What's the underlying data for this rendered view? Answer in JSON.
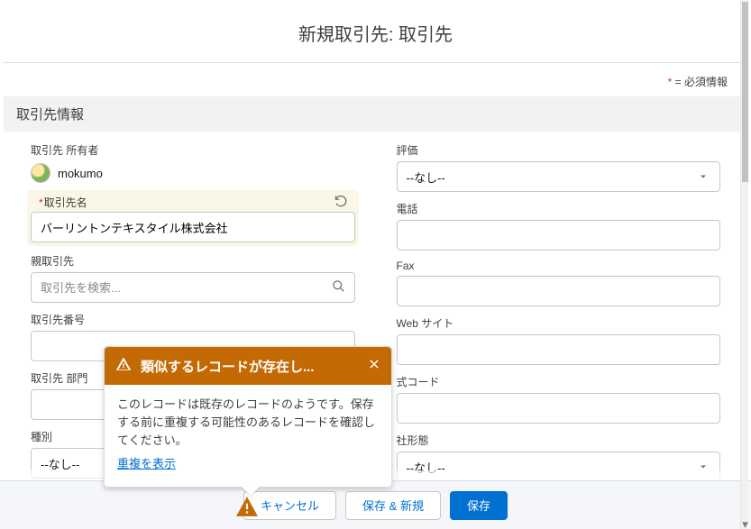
{
  "header": {
    "title": "新規取引先: 取引先",
    "required_legend": " = 必須情報"
  },
  "section": {
    "title": "取引先情報"
  },
  "left": {
    "owner": {
      "label": "取引先 所有者",
      "value": "mokumo"
    },
    "account_name": {
      "label": "取引先名",
      "value": "バーリントンテキスタイル株式会社"
    },
    "parent_account": {
      "label": "親取引先",
      "placeholder": "取引先を検索..."
    },
    "account_number": {
      "label": "取引先番号"
    },
    "account_department": {
      "label": "取引先 部門"
    },
    "type": {
      "label": "種別",
      "value": "--なし--"
    }
  },
  "right": {
    "rating": {
      "label": "評価",
      "value": "--なし--"
    },
    "phone": {
      "label": "電話"
    },
    "fax": {
      "label": "Fax"
    },
    "website": {
      "label": "Web サイト"
    },
    "stock_code": {
      "label": "式コード"
    },
    "ownership": {
      "label": "社形態",
      "value": "--なし--"
    }
  },
  "popover": {
    "title": "類似するレコードが存在し...",
    "message": "このレコードは既存のレコードのようです。保存する前に重複する可能性のあるレコードを確認してください。",
    "link": "重複を表示"
  },
  "footer": {
    "cancel": "キャンセル",
    "save_new": "保存 & 新規",
    "save": "保存"
  }
}
